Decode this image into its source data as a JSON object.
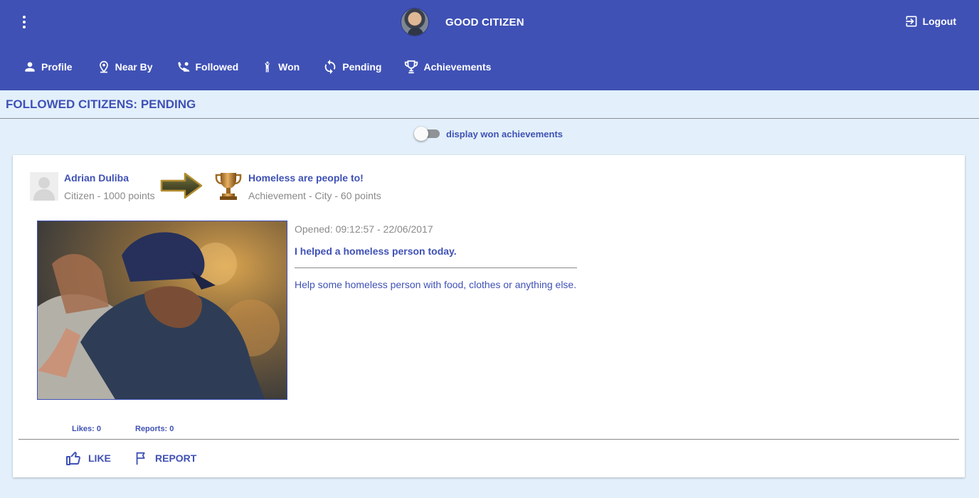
{
  "header": {
    "app_title": "GOOD CITIZEN",
    "logout_label": "Logout",
    "accent_color": "#3f51b5"
  },
  "nav": {
    "items": [
      {
        "label": "Profile",
        "icon": "person-icon"
      },
      {
        "label": "Near By",
        "icon": "location-pin-icon"
      },
      {
        "label": "Followed",
        "icon": "followed-icon"
      },
      {
        "label": "Won",
        "icon": "celebrate-person-icon"
      },
      {
        "label": "Pending",
        "icon": "sync-icon"
      },
      {
        "label": "Achievements",
        "icon": "trophy-icon"
      }
    ]
  },
  "page": {
    "title": "FOLLOWED CITIZENS: PENDING",
    "toggle_label": "display won achievements",
    "toggle_on": false
  },
  "card": {
    "user_name": "Adrian Duliba",
    "user_subtitle": "Citizen - 1000 points",
    "achievement_name": "Homeless are people to!",
    "achievement_subtitle": "Achievement - City - 60 points",
    "opened": "Opened: 09:12:57 - 22/06/2017",
    "task_title": "I helped a homeless person today.",
    "task_description": "Help some homeless person with food, clothes or anything else.",
    "likes": "Likes: 0",
    "reports": "Reports: 0",
    "like_label": "LIKE",
    "report_label": "REPORT"
  }
}
